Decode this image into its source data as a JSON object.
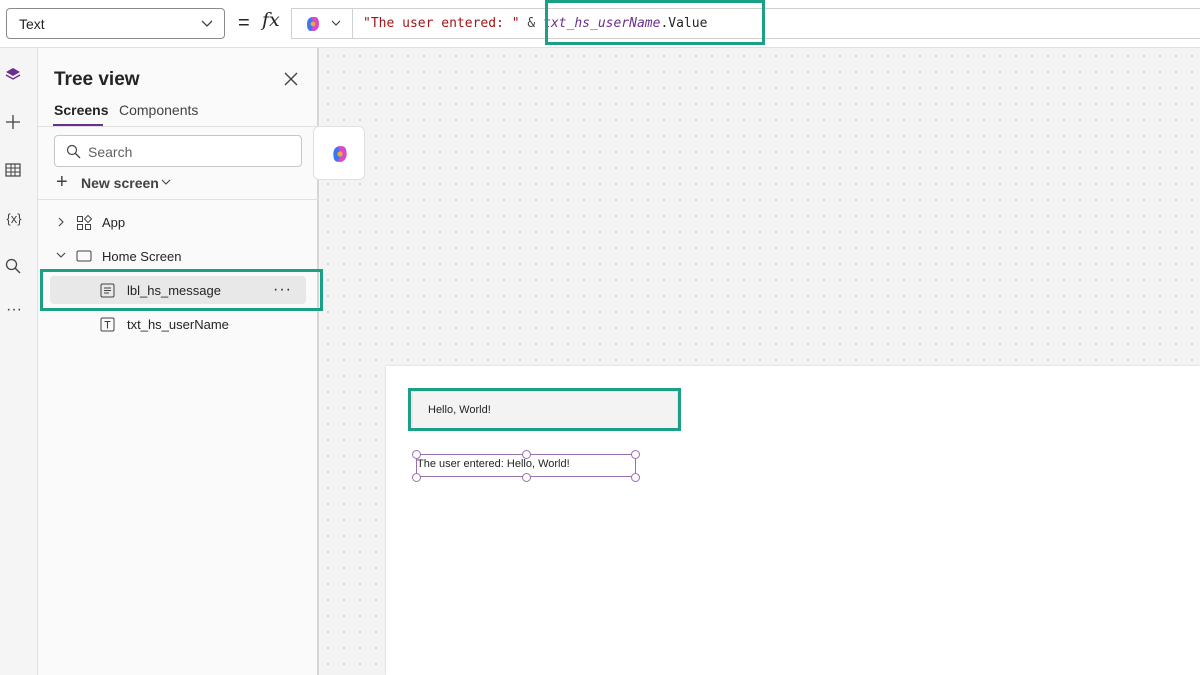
{
  "formula_bar": {
    "property": "Text",
    "equals": "=",
    "fx": "fx",
    "formula": {
      "string_part": "\"The user entered: \"",
      "operator": " & ",
      "identifier": "txt_hs_userName",
      "property_part": ".Value"
    }
  },
  "tree": {
    "title": "Tree view",
    "tabs": [
      "Screens",
      "Components"
    ],
    "search_placeholder": "Search",
    "new_screen_label": "New screen",
    "nodes": [
      {
        "label": "App",
        "icon": "app-icon"
      },
      {
        "label": "Home Screen",
        "icon": "screen-icon"
      },
      {
        "label": "lbl_hs_message",
        "icon": "label-icon",
        "selected": true
      },
      {
        "label": "txt_hs_userName",
        "icon": "text-input-icon"
      }
    ],
    "more_label": "···"
  },
  "rail_icons": [
    "layers-icon",
    "add-icon",
    "data-table-icon",
    "variables-icon",
    "search-icon",
    "more-icon"
  ],
  "rail_labels": {
    "variables": "{x}",
    "more": "···"
  },
  "canvas": {
    "text_input_value": "Hello, World!",
    "label_text": "The user entered: Hello, World!"
  },
  "colors": {
    "accent": "#6b2f8f",
    "highlight": "#1aa085",
    "selection": "#9a6fb0"
  }
}
